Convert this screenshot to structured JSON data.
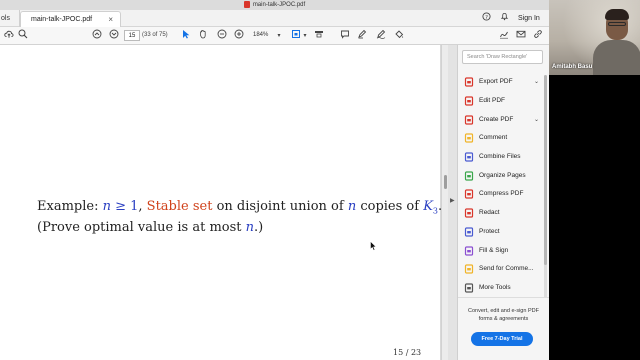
{
  "window": {
    "title": "main-talk-JPOC.pdf"
  },
  "tabbar": {
    "tools_label": "ols",
    "doc_tab": "main-talk-JPOC.pdf",
    "close_glyph": "×",
    "signin": "Sign In"
  },
  "toolbar": {
    "page_value": "15",
    "page_count": "(33 of 75)",
    "zoom": "184%"
  },
  "slide": {
    "line1": {
      "prefix": "Example: ",
      "cond_n": "n",
      "cond_rest": " ≥ 1",
      "comma": ", ",
      "stable": "Stable set",
      "mid": " on disjoint union of ",
      "n2": "n",
      "copies": " copies of ",
      "K": "K",
      "sub": "3",
      "end": "."
    },
    "line2": {
      "pre": "(Prove optimal value is at most ",
      "n": "n",
      "post": ".)"
    },
    "page_number": "15 / 23"
  },
  "pane": {
    "search_placeholder": "Search 'Draw Rectangle'",
    "items": [
      {
        "label": "Export PDF",
        "icon": "export-pdf-icon",
        "color": "#d9362b",
        "chevron": true
      },
      {
        "label": "Edit PDF",
        "icon": "edit-pdf-icon",
        "color": "#d9362b",
        "chevron": false
      },
      {
        "label": "Create PDF",
        "icon": "create-pdf-icon",
        "color": "#d9362b",
        "chevron": true
      },
      {
        "label": "Comment",
        "icon": "comment-icon",
        "color": "#f0b429",
        "chevron": false
      },
      {
        "label": "Combine Files",
        "icon": "combine-files-icon",
        "color": "#4a5bd1",
        "chevron": false
      },
      {
        "label": "Organize Pages",
        "icon": "organize-pages-icon",
        "color": "#3aa64b",
        "chevron": false
      },
      {
        "label": "Compress PDF",
        "icon": "compress-pdf-icon",
        "color": "#d9362b",
        "chevron": false
      },
      {
        "label": "Redact",
        "icon": "redact-icon",
        "color": "#d9362b",
        "chevron": false
      },
      {
        "label": "Protect",
        "icon": "protect-icon",
        "color": "#4a5bd1",
        "chevron": false
      },
      {
        "label": "Fill & Sign",
        "icon": "fill-sign-icon",
        "color": "#8b4fd1",
        "chevron": false
      },
      {
        "label": "Send for Comme...",
        "icon": "send-for-comment-icon",
        "color": "#f0b429",
        "chevron": false
      },
      {
        "label": "More Tools",
        "icon": "more-tools-icon",
        "color": "#555555",
        "chevron": false
      }
    ],
    "promo_text": "Convert, edit and e-sign PDF forms & agreements",
    "trial_button": "Free 7-Day Trial"
  },
  "video": {
    "participant_name": "Amitabh Basu"
  },
  "colors": {
    "accent": "#1473e6",
    "math_blue": "#2a3fc2",
    "stable_red": "#d0421b"
  }
}
